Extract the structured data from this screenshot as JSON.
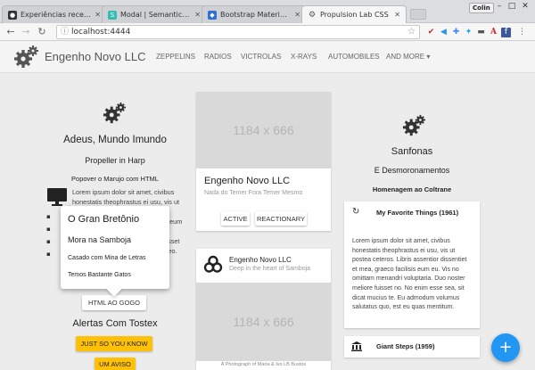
{
  "browser": {
    "tabs": [
      {
        "title": "Experiências recentes"
      },
      {
        "title": "Modal | Semantic UI"
      },
      {
        "title": "Bootstrap Material Ep"
      },
      {
        "title": "Propulsion Lab CSS"
      }
    ],
    "user_label": "Colin",
    "url": "localhost:4444"
  },
  "site": {
    "brand": "Engenho Novo LLC",
    "nav": [
      "ZEPPELINS",
      "RADIOS",
      "VICTROLAS",
      "X-RAYS",
      "AUTOMOBILES",
      "AND MORE ▾"
    ]
  },
  "left": {
    "title": "Adeus, Mundo Imundo",
    "subtitle": "Propeller in Harp",
    "popover_heading": "Popover o Marujo com HTML",
    "lorem": "Lorem ipsum dolor sit amet, civibus honestatis theophrastus ei usu, vis ut postea ceteros. Libris assentior dissentiet et mea, graeco facilisis eum eu. Vis no omittam menandri voluptaria. Duo noster meliore fuisset no. No enim esse sea, sit dicat meo.",
    "popover_items": [
      "O Gran Bretônio",
      "Mora na Samboja",
      "Casado com Mina de Letras",
      "Temos Bastante Gatos"
    ],
    "html_button": "HTML AO GOGO",
    "alerts_title": "Alertas Com Tostex",
    "btn_just": "JUST SO YOU KNOW",
    "btn_um": "UM AVISO"
  },
  "middle": {
    "card1": {
      "ph": "1184 x 666",
      "title": "Engenho Novo LLC",
      "subtitle": "Nada do Temer Fora Temer Mesmo",
      "btn_active": "ACTIVE",
      "btn_reactionary": "REACTIONARY"
    },
    "card2": {
      "title": "Engenho Novo LLC",
      "subtitle": "Deep in the heart of Samboja",
      "ph": "1184 x 666",
      "caption": "A Photograph of Maria & Ivo LB Bustos"
    }
  },
  "right": {
    "title": "Sanfonas",
    "subtitle": "E Desmoronamentos",
    "tagline": "Homenagem ao Coltrane",
    "list1_title": "My Favorite Things (1961)",
    "list1_text": "Lorem ipsum dolor sit amet, civibus honestatis theophrastus ei usu, vis ut postea ceteros. Libris assentior dissentiet et mea, graeco facilisis eum eu. Vis no omittam menandri voluptaria. Duo noster meliore fuisset no. No enim esse sea, sit dicat mucius te. Eu admodum volumus salutatus quo, est eu quas mentitum.",
    "list2_title": "Giant Steps (1959)"
  },
  "fab_label": "+",
  "colors": {
    "accent": "#2196f3",
    "amber": "#ffc107"
  }
}
